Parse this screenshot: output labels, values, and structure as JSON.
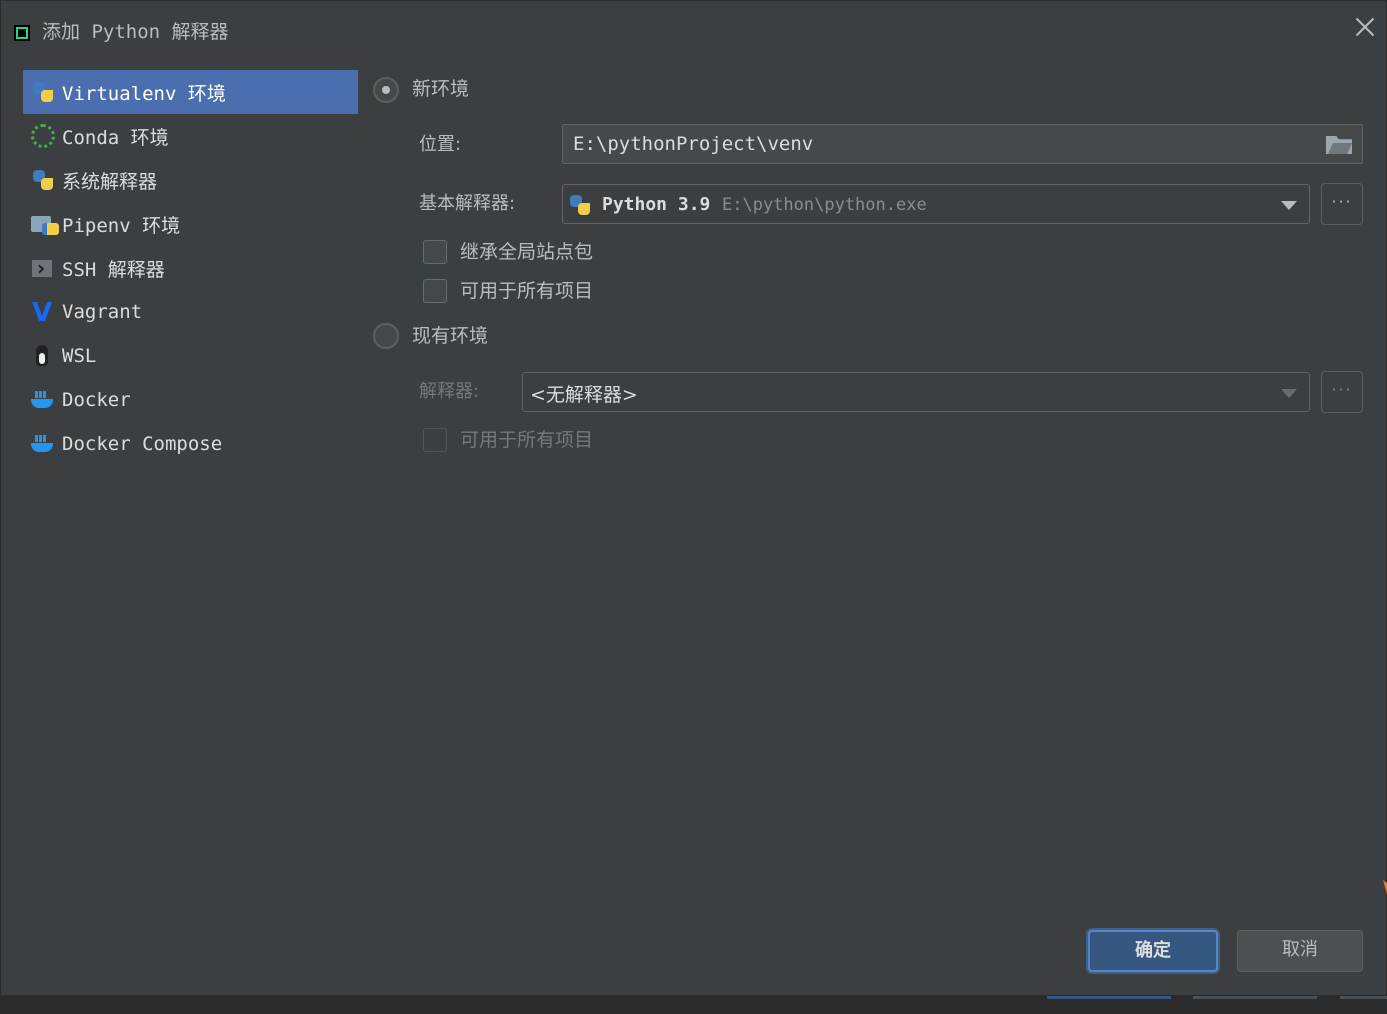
{
  "window": {
    "title": "添加 Python 解释器"
  },
  "sidebar": {
    "items": [
      {
        "label": "Virtualenv 环境",
        "icon": "virtualenv-icon",
        "active": true
      },
      {
        "label": "Conda 环境",
        "icon": "conda-icon"
      },
      {
        "label": "系统解释器",
        "icon": "python-icon"
      },
      {
        "label": "Pipenv 环境",
        "icon": "pipenv-icon"
      },
      {
        "label": "SSH 解释器",
        "icon": "ssh-icon"
      },
      {
        "label": "Vagrant",
        "icon": "vagrant-icon"
      },
      {
        "label": "WSL",
        "icon": "wsl-icon"
      },
      {
        "label": "Docker",
        "icon": "docker-icon"
      },
      {
        "label": "Docker Compose",
        "icon": "docker-compose-icon"
      }
    ]
  },
  "new_env": {
    "label": "新环境",
    "selected": true,
    "location_label": "位置:",
    "location_value": "E:\\pythonProject\\venv",
    "base_interpreter_label": "基本解释器:",
    "base_interpreter_name": "Python 3.9",
    "base_interpreter_path": "E:\\python\\python.exe",
    "more_label": "···",
    "inherit_label": "继承全局站点包",
    "available_all_label": "可用于所有项目"
  },
  "existing_env": {
    "label": "现有环境",
    "selected": false,
    "interpreter_label": "解释器:",
    "interpreter_value": "<无解释器>",
    "more_label": "···",
    "available_all_label": "可用于所有项目"
  },
  "footer": {
    "ok_label": "确定",
    "cancel_label": "取消"
  },
  "colors": {
    "background": "#3c3f41",
    "selection": "#4b6eaf",
    "primary_button": "#365880"
  }
}
